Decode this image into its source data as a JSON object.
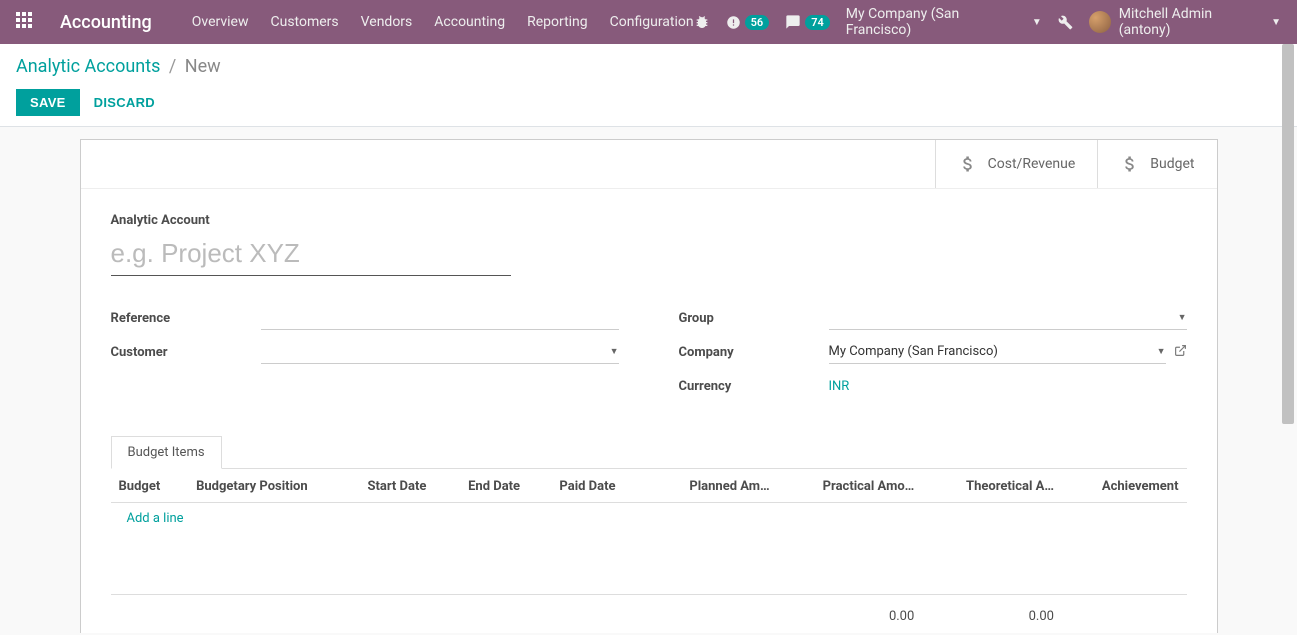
{
  "navbar": {
    "brand": "Accounting",
    "menu": [
      "Overview",
      "Customers",
      "Vendors",
      "Accounting",
      "Reporting",
      "Configuration"
    ],
    "badge_activities": "56",
    "badge_messages": "74",
    "company": "My Company (San Francisco)",
    "user": "Mitchell Admin (antony)"
  },
  "breadcrumb": {
    "parent": "Analytic Accounts",
    "current": "New"
  },
  "buttons": {
    "save": "SAVE",
    "discard": "DISCARD"
  },
  "stat_buttons": {
    "cost_revenue": "Cost/Revenue",
    "budget": "Budget"
  },
  "form": {
    "name_label": "Analytic Account",
    "name_placeholder": "e.g. Project XYZ",
    "name_value": "",
    "reference_label": "Reference",
    "reference_value": "",
    "customer_label": "Customer",
    "customer_value": "",
    "group_label": "Group",
    "group_value": "",
    "company_label": "Company",
    "company_value": "My Company (San Francisco)",
    "currency_label": "Currency",
    "currency_value": "INR"
  },
  "tabs": {
    "budget_items": "Budget Items"
  },
  "table": {
    "headers": {
      "budget": "Budget",
      "budgetary_position": "Budgetary Position",
      "start_date": "Start Date",
      "end_date": "End Date",
      "paid_date": "Paid Date",
      "planned_amount": "Planned Am…",
      "practical_amount": "Practical Amo…",
      "theoretical_amount": "Theoretical A…",
      "achievement": "Achievement"
    },
    "add_line": "Add a line",
    "totals": {
      "practical": "0.00",
      "theoretical": "0.00"
    }
  }
}
